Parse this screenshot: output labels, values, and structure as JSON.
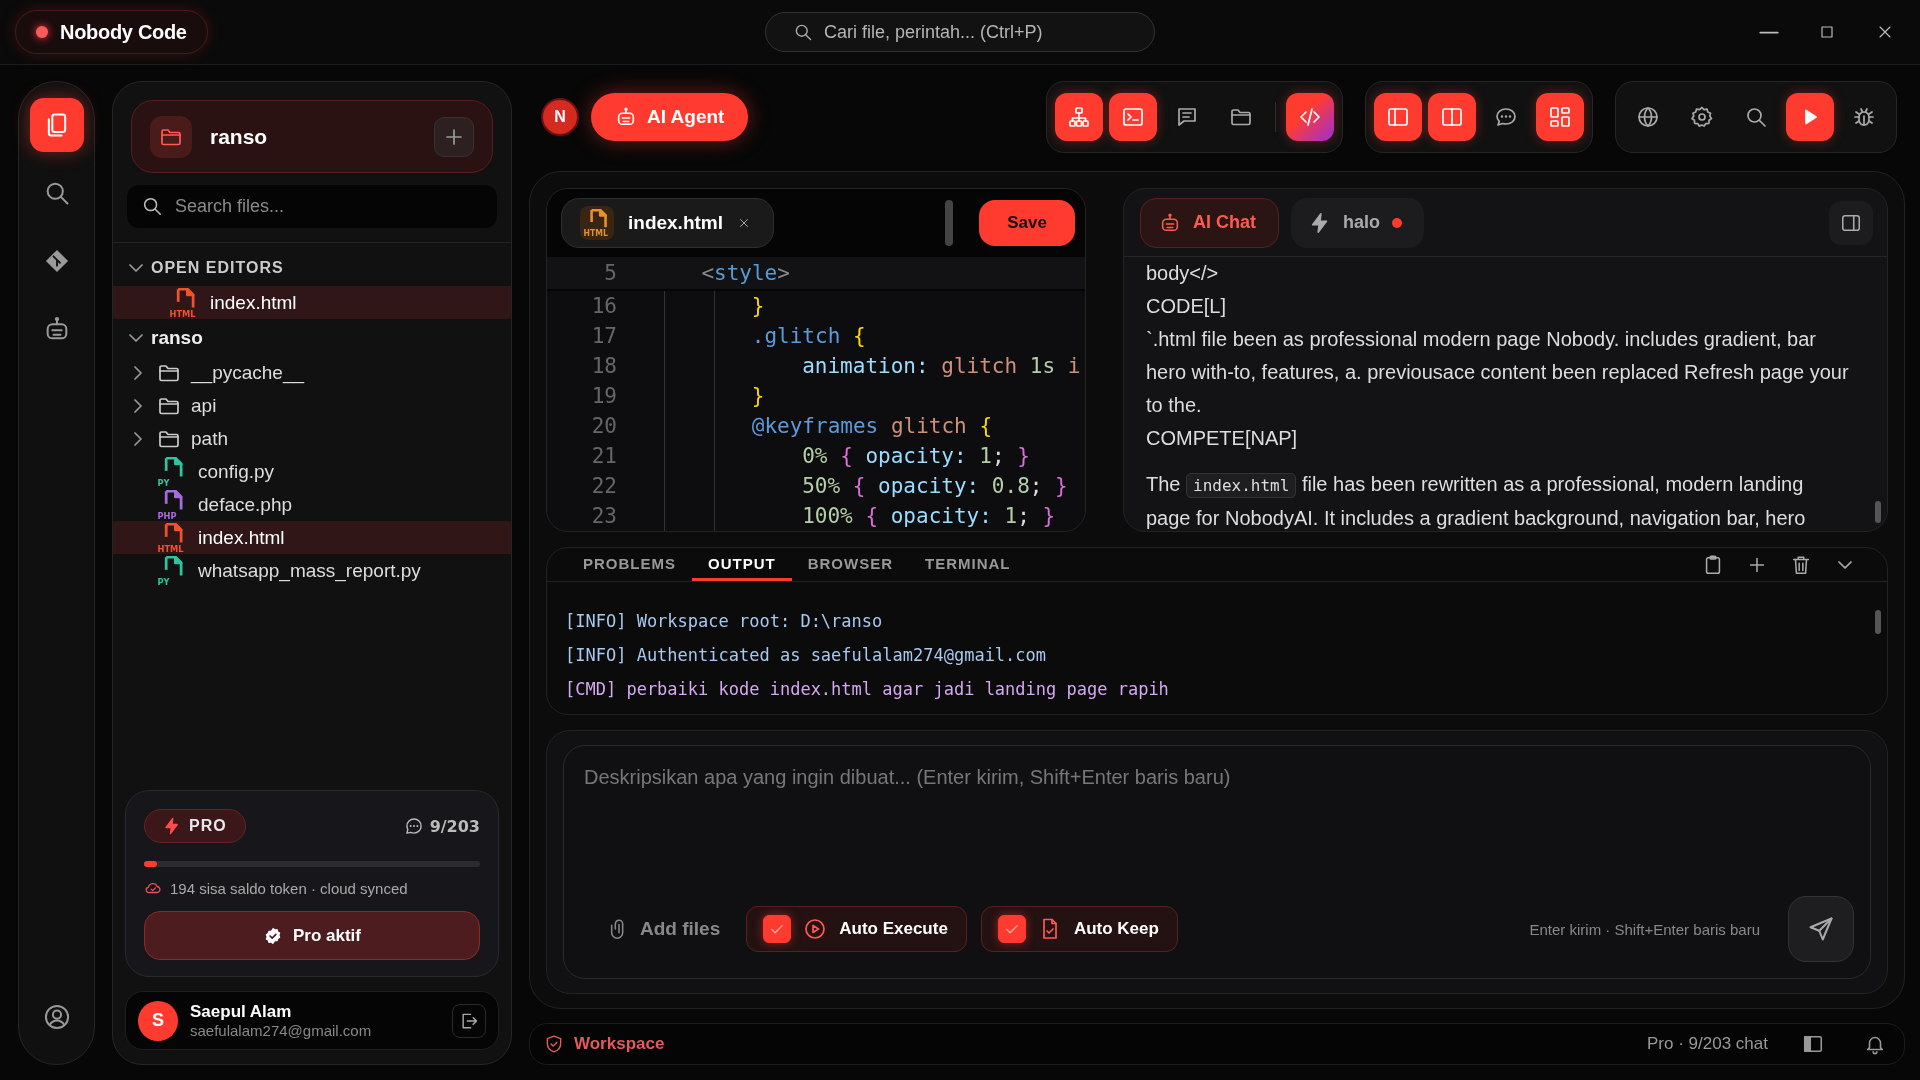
{
  "app": {
    "title": "Nobody Code"
  },
  "search": {
    "placeholder": "Cari file, perintah... (Ctrl+P)"
  },
  "activity_bar": {
    "items": [
      {
        "selected": true
      },
      {
        "selected": false
      },
      {
        "selected": false
      },
      {
        "selected": false
      }
    ]
  },
  "sidebar": {
    "project": {
      "name": "ranso"
    },
    "search": {
      "placeholder": "Search files..."
    },
    "open_editors": {
      "title": "OPEN EDITORS",
      "expanded": true,
      "items": [
        {
          "kind": "html",
          "name": "index.html",
          "badge": "HTML",
          "selected": true
        }
      ]
    },
    "tree": {
      "name": "ranso",
      "expanded": true,
      "children": [
        {
          "kind": "folder",
          "name": "__pycache__",
          "expanded": false,
          "selected": false
        },
        {
          "kind": "folder",
          "name": "api",
          "expanded": false,
          "selected": false
        },
        {
          "kind": "folder",
          "name": "path",
          "expanded": false,
          "selected": false
        },
        {
          "kind": "python",
          "name": "config.py",
          "badge": "PY",
          "selected": false
        },
        {
          "kind": "php",
          "name": "deface.php",
          "badge": "PHP",
          "selected": false
        },
        {
          "kind": "html",
          "name": "index.html",
          "badge": "HTML",
          "selected": true
        },
        {
          "kind": "python",
          "name": "whatsapp_mass_report.py",
          "badge": "PY",
          "selected": false
        }
      ]
    },
    "plan": {
      "badge": "PRO",
      "usage": "9/203",
      "level": 0.04,
      "note": "194 sisa saldo token · cloud synced",
      "button": "Pro aktif"
    },
    "user": {
      "initial": "S",
      "name": "Saepul Alam",
      "email": "saefulalam274@gmail.com"
    }
  },
  "toolbar": {
    "avatar": "N",
    "agent_button": "AI Agent",
    "groups": [
      [
        {
          "on": true
        },
        {
          "on": true
        },
        {
          "on": false
        },
        {
          "on": false
        },
        {
          "on": true
        }
      ],
      [
        {
          "on": true
        },
        {
          "on": true
        },
        {
          "on": false
        },
        {
          "on": true
        }
      ],
      [
        {
          "on": false
        },
        {
          "on": false
        },
        {
          "on": false
        },
        {
          "on": true
        },
        {
          "on": false
        }
      ]
    ]
  },
  "editor": {
    "tabs": [
      {
        "name": "index.html",
        "badge": "HTML",
        "selected": true
      }
    ],
    "save": "Save",
    "sticky": {
      "number": "5",
      "tokens": [
        {
          "text": "    <",
          "kind": "punct"
        },
        {
          "text": "style",
          "kind": "tag"
        },
        {
          "text": ">",
          "kind": "punct"
        }
      ]
    },
    "lines": [
      {
        "number": "16",
        "tokens": [
          {
            "text": "        }",
            "kind": "brace"
          }
        ]
      },
      {
        "number": "17",
        "tokens": [
          {
            "text": "        .glitch ",
            "kind": "selector"
          },
          {
            "text": "{",
            "kind": "brace"
          }
        ]
      },
      {
        "number": "18",
        "tokens": [
          {
            "text": "            animation: ",
            "kind": "prop"
          },
          {
            "text": "glitch ",
            "kind": "string"
          },
          {
            "text": "1s ",
            "kind": "number"
          },
          {
            "text": "i",
            "kind": "string"
          }
        ]
      },
      {
        "number": "19",
        "tokens": [
          {
            "text": "        }",
            "kind": "brace"
          }
        ]
      },
      {
        "number": "20",
        "tokens": [
          {
            "text": "        @keyframes ",
            "kind": "selector"
          },
          {
            "text": "glitch ",
            "kind": "string"
          },
          {
            "text": "{",
            "kind": "brace"
          }
        ]
      },
      {
        "number": "21",
        "tokens": [
          {
            "text": "            0% ",
            "kind": "number"
          },
          {
            "text": "{ ",
            "kind": "brace2"
          },
          {
            "text": "opacity: ",
            "kind": "prop"
          },
          {
            "text": "1",
            "kind": "number"
          },
          {
            "text": "; ",
            "kind": "plain"
          },
          {
            "text": "}",
            "kind": "brace2"
          }
        ]
      },
      {
        "number": "22",
        "tokens": [
          {
            "text": "            50% ",
            "kind": "number"
          },
          {
            "text": "{ ",
            "kind": "brace2"
          },
          {
            "text": "opacity: ",
            "kind": "prop"
          },
          {
            "text": "0.8",
            "kind": "number"
          },
          {
            "text": "; ",
            "kind": "plain"
          },
          {
            "text": "}",
            "kind": "brace2"
          }
        ]
      },
      {
        "number": "23",
        "tokens": [
          {
            "text": "            100% ",
            "kind": "number"
          },
          {
            "text": "{ ",
            "kind": "brace2"
          },
          {
            "text": "opacity: ",
            "kind": "prop"
          },
          {
            "text": "1",
            "kind": "number"
          },
          {
            "text": "; ",
            "kind": "plain"
          },
          {
            "text": "}",
            "kind": "brace2"
          }
        ]
      }
    ]
  },
  "chat": {
    "tabs": [
      {
        "label": "AI Chat",
        "selected": true,
        "unread": false
      },
      {
        "label": "halo",
        "selected": false,
        "unread": true
      }
    ],
    "messages": [
      {
        "kind": "text",
        "text": "body</>"
      },
      {
        "kind": "text",
        "text": "CODE[L]"
      },
      {
        "kind": "text",
        "text": "`.html file been as professional modern page Nobody. includes gradient, bar hero with-to, features, a. previousace content been replaced Refresh page your to the."
      },
      {
        "kind": "text",
        "text": "COMPETE[NAP]"
      },
      {
        "kind": "code_mix",
        "before": "The",
        "code": "index.html",
        "after": "file has been rewritten as a professional, modern landing page for NobodyAI. It includes a gradient background, navigation bar, hero"
      }
    ]
  },
  "output": {
    "tabs": [
      {
        "label": "PROBLEMS",
        "selected": false
      },
      {
        "label": "OUTPUT",
        "selected": true
      },
      {
        "label": "BROWSER",
        "selected": false
      },
      {
        "label": "TERMINAL",
        "selected": false
      }
    ],
    "lines": [
      {
        "kind": "info",
        "text": "[INFO] Workspace root: D:\\ranso"
      },
      {
        "kind": "info",
        "text": "[INFO] Authenticated as saefulalam274@gmail.com"
      },
      {
        "kind": "cmd",
        "text": "[CMD] perbaiki kode index.html agar jadi landing page rapih"
      }
    ]
  },
  "composer": {
    "placeholder": "Deskripsikan apa yang ingin dibuat... (Enter kirim, Shift+Enter baris baru)",
    "add_files": "Add files",
    "toggles": [
      {
        "label": "Auto Execute",
        "checked": true
      },
      {
        "label": "Auto Keep",
        "checked": true
      }
    ],
    "hint": "Enter kirim · Shift+Enter baris baru"
  },
  "status_bar": {
    "workspace": "Workspace",
    "usage": "Pro · 9/203 chat"
  }
}
